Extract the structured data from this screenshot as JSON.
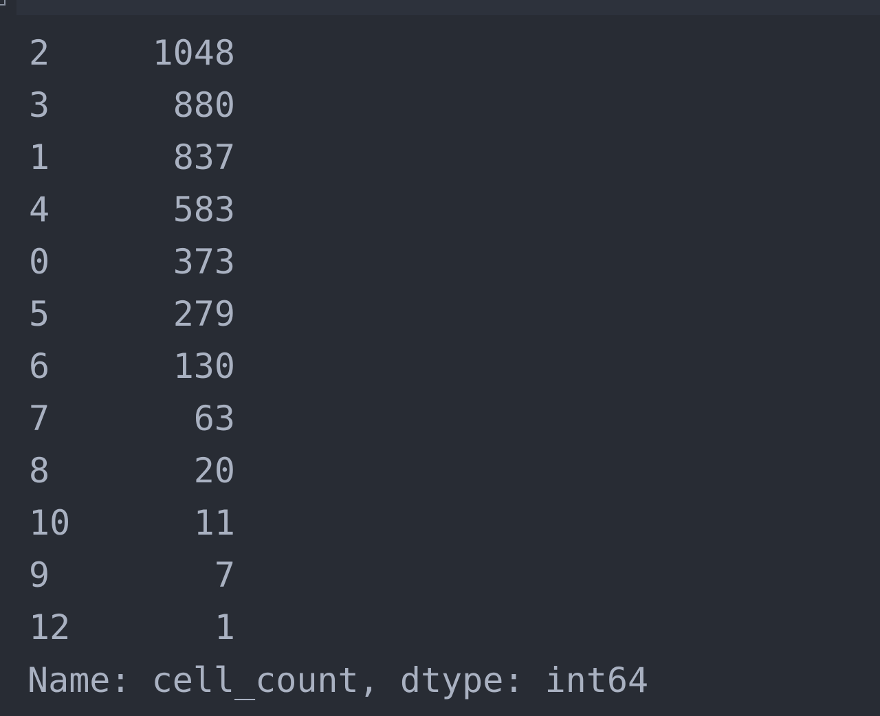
{
  "series_output": {
    "rows": [
      {
        "index": "2",
        "value": "1048"
      },
      {
        "index": "3",
        "value": "880"
      },
      {
        "index": "1",
        "value": "837"
      },
      {
        "index": "4",
        "value": "583"
      },
      {
        "index": "0",
        "value": "373"
      },
      {
        "index": "5",
        "value": "279"
      },
      {
        "index": "6",
        "value": "130"
      },
      {
        "index": "7",
        "value": "63"
      },
      {
        "index": "8",
        "value": "20"
      },
      {
        "index": "10",
        "value": "11"
      },
      {
        "index": "9",
        "value": "7"
      },
      {
        "index": "12",
        "value": "1"
      }
    ],
    "footer": "Name: cell_count, dtype: int64"
  }
}
